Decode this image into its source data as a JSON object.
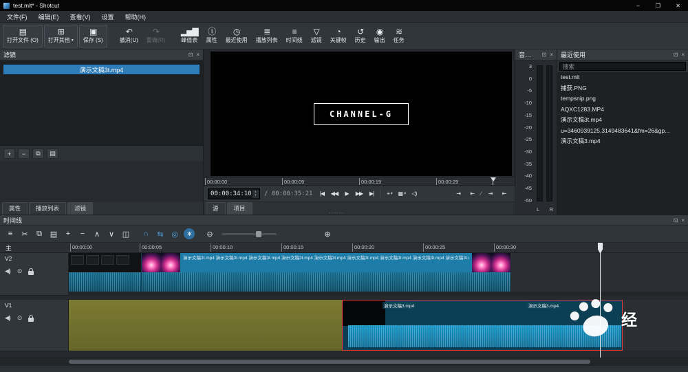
{
  "colors": {
    "accent_blue": "#2e7cb8",
    "clip_blue": "#1e7ca8",
    "clip_audio_teal": "#0e5d7c",
    "clip_olive": "#6f7030",
    "selection_red": "#e03c3c",
    "active_icon_blue": "#4da3dd"
  },
  "titlebar": {
    "title": "test.mlt* - Shotcut",
    "minimize": "–",
    "restore": "❐",
    "close": "✕"
  },
  "menubar": {
    "items": [
      {
        "label": "文件(F)"
      },
      {
        "label": "编辑(E)"
      },
      {
        "label": "查看(V)"
      },
      {
        "label": "设置"
      },
      {
        "label": "帮助(H)"
      }
    ]
  },
  "toolbar": {
    "buttons": [
      {
        "name": "open-file",
        "glyph": "▤",
        "label": "打开文件 (O)"
      },
      {
        "name": "open-other",
        "glyph": "⊞",
        "label": "打开其他",
        "caret": "▾"
      },
      {
        "name": "save",
        "glyph": "▣",
        "label": "保存 (S)"
      },
      {
        "name": "undo",
        "glyph": "↶",
        "label": "撤消(U)"
      },
      {
        "name": "redo",
        "glyph": "↷",
        "label": "重做(R)"
      },
      {
        "name": "peak-meter",
        "glyph": "▂▅▇",
        "label": "峰值表"
      },
      {
        "name": "properties",
        "glyph": "ⓘ",
        "label": "属性"
      },
      {
        "name": "recent",
        "glyph": "◷",
        "label": "最近使用"
      },
      {
        "name": "playlist",
        "glyph": "≣",
        "label": "播放列表"
      },
      {
        "name": "timeline",
        "glyph": "≡",
        "label": "时间线"
      },
      {
        "name": "filters",
        "glyph": "▽",
        "label": "滤镜"
      },
      {
        "name": "keyframes",
        "glyph": "◔",
        "label": "关键帧"
      },
      {
        "name": "history",
        "glyph": "↺",
        "label": "历史"
      },
      {
        "name": "export",
        "glyph": "◉",
        "label": "输出"
      },
      {
        "name": "jobs",
        "glyph": "≋",
        "label": "任务"
      }
    ]
  },
  "filters_panel": {
    "title": "滤镜",
    "float_icon": "⊡",
    "close_icon": "×",
    "selected_clip": "演示文稿3t.mp4",
    "add": "+",
    "remove": "−",
    "copy": "⧉",
    "paste": "▤"
  },
  "left_tabs": {
    "tab0": "属性",
    "tab1": "播放列表",
    "tab2": "滤镜"
  },
  "preview": {
    "overlay": "CHANNEL-G",
    "ruler": [
      "00:00:00",
      "00:00:09",
      "00:00:19",
      "00:00:29"
    ],
    "current": "00:00:34:10",
    "total": "/ 00:00:35:21",
    "spin_up": "▴",
    "spin_down": "▾",
    "btn_skip_start": "|◀",
    "btn_rewind": "◀◀",
    "btn_play": "▶",
    "btn_ffwd": "▶▶",
    "btn_skip_end": "▶|",
    "btn_loop": "⌖",
    "btn_grid": "▦",
    "caret": "▾",
    "btn_volume": "◁)",
    "trim": [
      "⇥",
      "⇤",
      "∕",
      "⇥",
      "⇤"
    ],
    "tab_source": "源",
    "tab_project": "项目"
  },
  "audio_meter": {
    "title": "音…",
    "float_icon": "⊡",
    "close_icon": "×",
    "scale": [
      "3",
      "0",
      "-5",
      "-10",
      "-15",
      "-20",
      "-25",
      "-30",
      "-35",
      "-40",
      "-45",
      "-50"
    ],
    "left": "L",
    "right": "R"
  },
  "recent_panel": {
    "title": "最近使用",
    "float_icon": "⊡",
    "close_icon": "×",
    "search_placeholder": "搜索",
    "items": [
      {
        "label": "test.mlt"
      },
      {
        "label": "捕获.PNG"
      },
      {
        "label": "tempsnip.png"
      },
      {
        "label": "AQXC1283.MP4"
      },
      {
        "label": "演示文稿3t.mp4"
      },
      {
        "label": "u=3460939125,3149483641&fm=26&gp..."
      },
      {
        "label": "演示文稿3.mp4"
      }
    ]
  },
  "timeline": {
    "title": "时间线",
    "float_icon": "⊡",
    "close_icon": "×",
    "buttons": [
      {
        "name": "timeline-menu",
        "glyph": "≡"
      },
      {
        "name": "cut",
        "glyph": "✂"
      },
      {
        "name": "copy",
        "glyph": "⧉"
      },
      {
        "name": "paste",
        "glyph": "▤"
      },
      {
        "name": "append",
        "glyph": "+"
      },
      {
        "name": "ripple-delete",
        "glyph": "−"
      },
      {
        "name": "lift",
        "glyph": "∧"
      },
      {
        "name": "overwrite",
        "glyph": "∨"
      },
      {
        "name": "split",
        "glyph": "◫"
      },
      {
        "name": "snap",
        "glyph": "∩"
      },
      {
        "name": "scrub-while-dragging",
        "glyph": "⇆"
      },
      {
        "name": "ripple",
        "glyph": "◎"
      },
      {
        "name": "ripple-all-tracks",
        "glyph": "∗"
      },
      {
        "name": "zoom-out",
        "glyph": "⊖"
      },
      {
        "name": "zoom-in",
        "glyph": "⊕"
      }
    ],
    "ruler": [
      "00:00:00",
      "00:00:05",
      "00:00:10",
      "00:00:15",
      "00:00:20",
      "00:00:25",
      "00:00:30"
    ],
    "master": "主",
    "track_v2": "V2",
    "track_v1": "V1",
    "mute_icon": "◀)",
    "hide_icon": "⊙",
    "clip_v2_label": "演示文稿3t.mp4",
    "clip_v1_label": "演示文稿3.mp4"
  },
  "watermark": {
    "text": "经"
  },
  "misc": {
    "splitter": "······"
  }
}
